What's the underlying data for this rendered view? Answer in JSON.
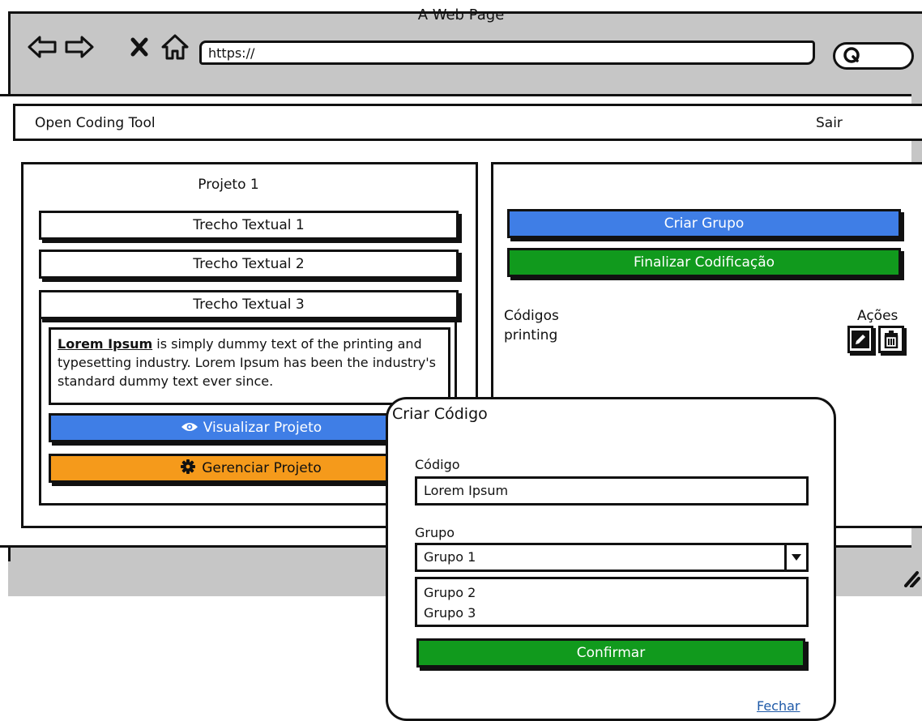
{
  "browser": {
    "title": "A Web Page",
    "url": "https://"
  },
  "app": {
    "title": "Open Coding Tool",
    "logout_label": "Sair"
  },
  "project": {
    "title": "Projeto 1",
    "snippets": [
      {
        "label": "Trecho Textual 1"
      },
      {
        "label": "Trecho Textual 2"
      },
      {
        "label": "Trecho Textual 3"
      }
    ],
    "text_strong": "Lorem Ipsum",
    "text_rest": " is simply dummy text of the printing and typesetting industry. Lorem Ipsum has been the industry's standard dummy text ever since.",
    "view_label": "Visualizar Projeto",
    "manage_label": "Gerenciar Projeto"
  },
  "groups": {
    "create_label": "Criar Grupo",
    "finish_label": "Finalizar Codificação",
    "codes_header": "Códigos",
    "actions_header": "Ações",
    "codes": [
      "printing"
    ]
  },
  "dialog": {
    "title": "Criar Código",
    "code_label": "Código",
    "code_value": "Lorem Ipsum",
    "group_label": "Grupo",
    "group_selected": "Grupo 1",
    "group_options": [
      "Grupo 2",
      "Grupo 3"
    ],
    "confirm_label": "Confirmar",
    "close_label": "Fechar"
  },
  "colors": {
    "blue": "#3f7ee6",
    "green": "#119a1d",
    "orange": "#f59a1b",
    "link": "#1f5aa8",
    "chrome": "#c6c6c6"
  },
  "icons": [
    "back-icon",
    "forward-icon",
    "close-icon",
    "home-icon",
    "search-icon",
    "eye-icon",
    "gear-icon",
    "pencil-icon",
    "trash-icon",
    "chevron-down-icon",
    "resize-grip-icon"
  ]
}
